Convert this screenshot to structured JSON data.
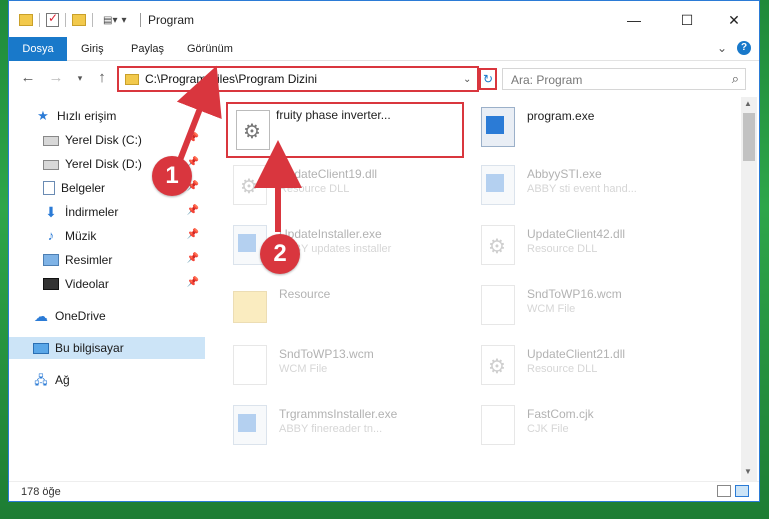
{
  "titlebar": {
    "title": "Program",
    "minimize": "—",
    "maximize": "☐",
    "close": "✕"
  },
  "ribbon": {
    "tabs": [
      "Dosya",
      "Giriş",
      "Paylaş",
      "Görünüm"
    ],
    "help": "?",
    "expand": "⌄"
  },
  "address": {
    "path": "C:\\Program Files\\Program Dizini",
    "search_placeholder": "Ara: Program"
  },
  "sidebar": {
    "items": [
      {
        "label": "Hızlı erişim",
        "icon": "star-icon"
      },
      {
        "label": "Yerel Disk (C:)",
        "icon": "disk-icon"
      },
      {
        "label": "Yerel Disk (D:)",
        "icon": "disk-icon"
      },
      {
        "label": "Belgeler",
        "icon": "document-icon"
      },
      {
        "label": "İndirmeler",
        "icon": "download-icon"
      },
      {
        "label": "Müzik",
        "icon": "music-icon"
      },
      {
        "label": "Resimler",
        "icon": "pictures-icon"
      },
      {
        "label": "Videolar",
        "icon": "videos-icon"
      },
      {
        "label": "OneDrive",
        "icon": "cloud-icon"
      },
      {
        "label": "Bu bilgisayar",
        "icon": "computer-icon"
      },
      {
        "label": "Ağ",
        "icon": "network-icon"
      }
    ]
  },
  "files": [
    {
      "name": "fruity phase inverter...",
      "type": ""
    },
    {
      "name": "program.exe",
      "type": ""
    },
    {
      "name": "UpdateClient19.dll",
      "type": "Resource DLL"
    },
    {
      "name": "AbbyySTI.exe",
      "type": "ABBY sti event hand..."
    },
    {
      "name": "UpdateInstaller.exe",
      "type": "ABBY updates installer"
    },
    {
      "name": "UpdateClient42.dll",
      "type": "Resource DLL"
    },
    {
      "name": "Resource",
      "type": ""
    },
    {
      "name": "SndToWP16.wcm",
      "type": "WCM File"
    },
    {
      "name": "SndToWP13.wcm",
      "type": "WCM File"
    },
    {
      "name": "UpdateClient21.dll",
      "type": "Resource DLL"
    },
    {
      "name": "TrgrammsInstaller.exe",
      "type": "ABBY finereader tn..."
    },
    {
      "name": "FastCom.cjk",
      "type": "CJK File"
    }
  ],
  "status": {
    "count": "178 öğe"
  },
  "callouts": [
    "1",
    "2"
  ]
}
